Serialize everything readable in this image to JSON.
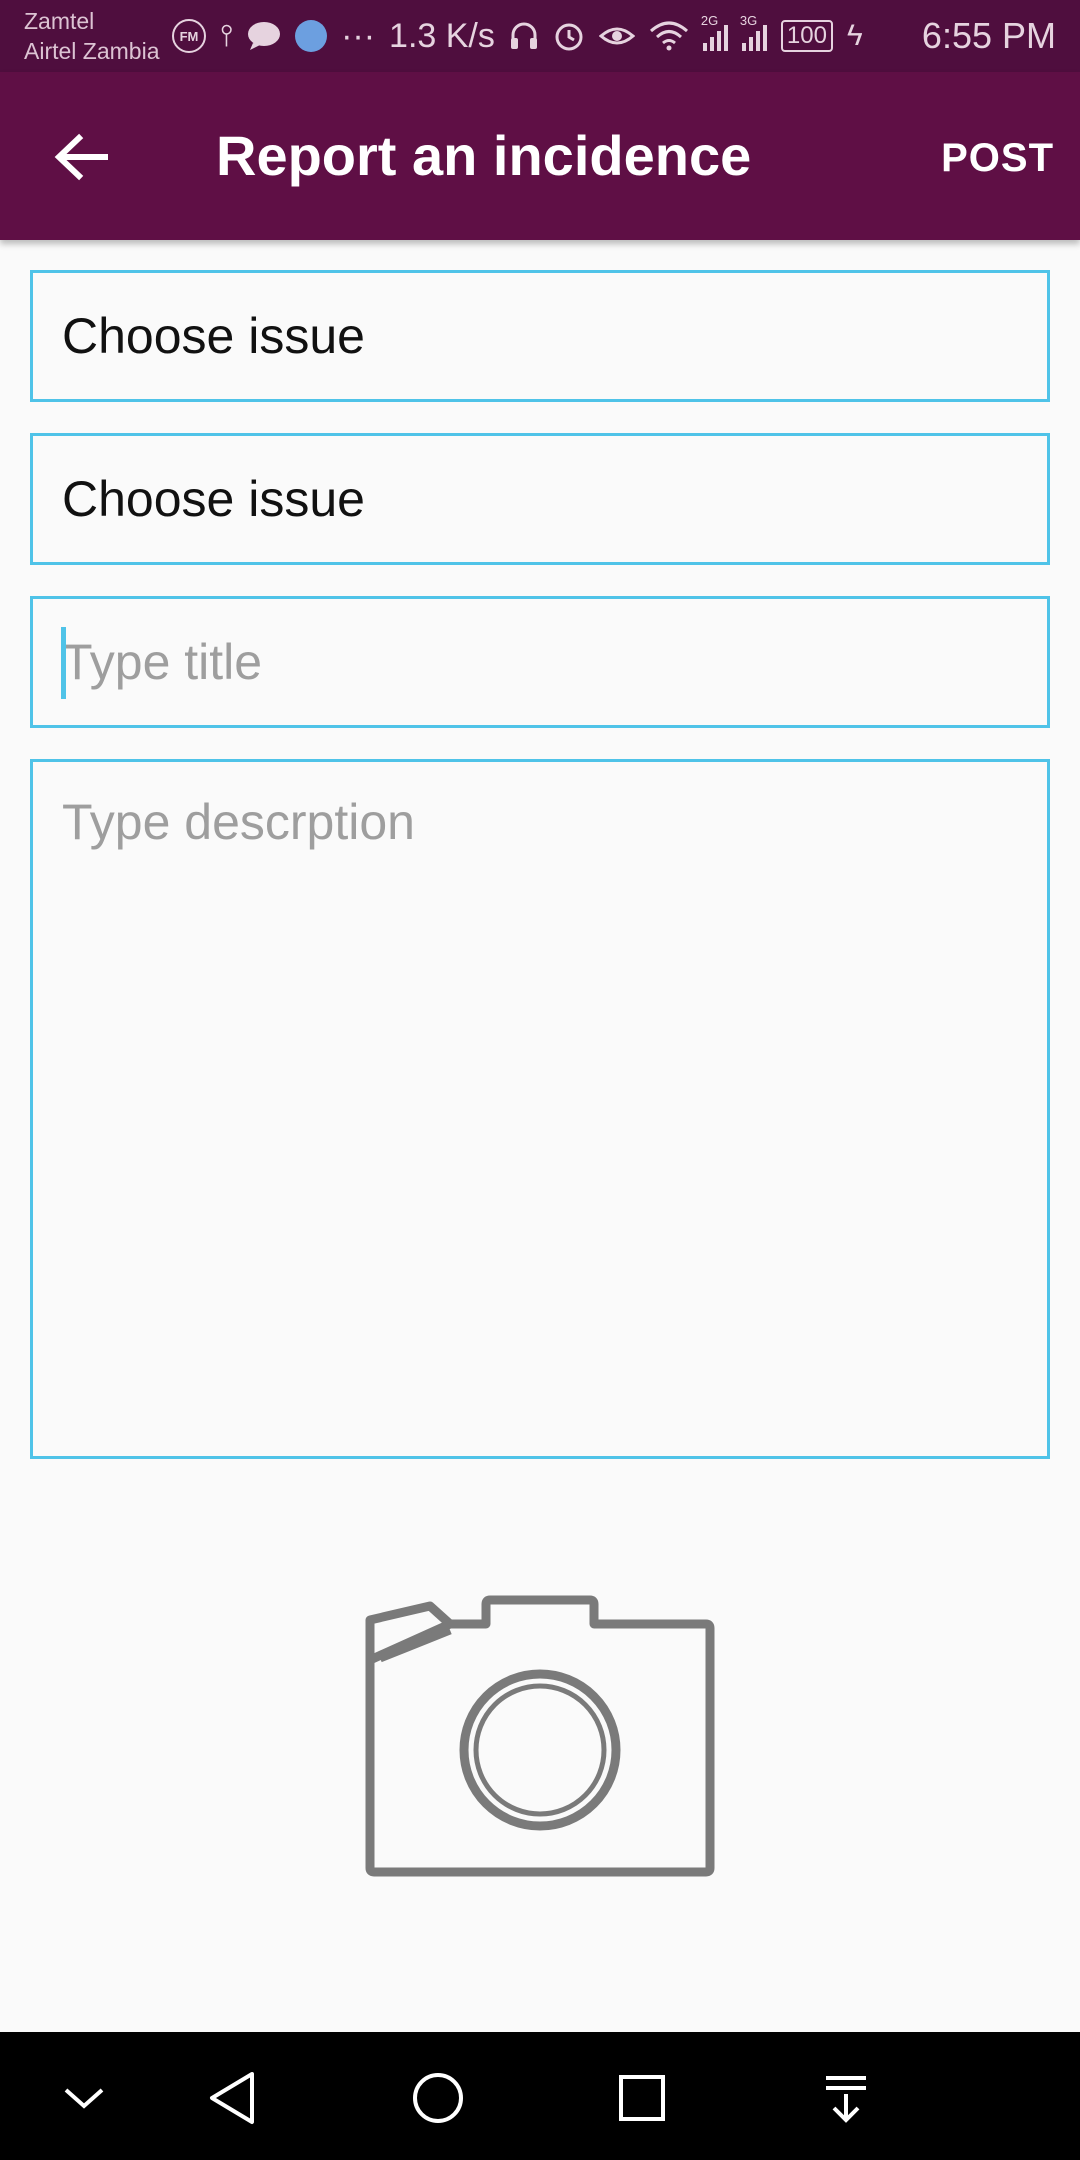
{
  "status_bar": {
    "carrier_1": "Zamtel",
    "carrier_2": "Airtel Zambia",
    "fm_label": "FM",
    "overflow": "···",
    "net_speed": "1.3 K/s",
    "signal_1_label": "2G",
    "signal_2_label": "3G",
    "battery": "100",
    "time": "6:55 PM"
  },
  "app_bar": {
    "title": "Report an incidence",
    "post_label": "POST",
    "color": "#5f0f45"
  },
  "form": {
    "issue_select_1": "Choose issue",
    "issue_select_2": "Choose issue",
    "title_placeholder": "Type title",
    "description_placeholder": "Type descrption",
    "border_color": "#4fc3e8"
  },
  "icons": {
    "back": "arrow-left-icon",
    "attach": "camera-icon",
    "nav": [
      "chevron-down-icon",
      "back-triangle-icon",
      "home-circle-icon",
      "recents-square-icon",
      "notification-pull-icon"
    ]
  }
}
